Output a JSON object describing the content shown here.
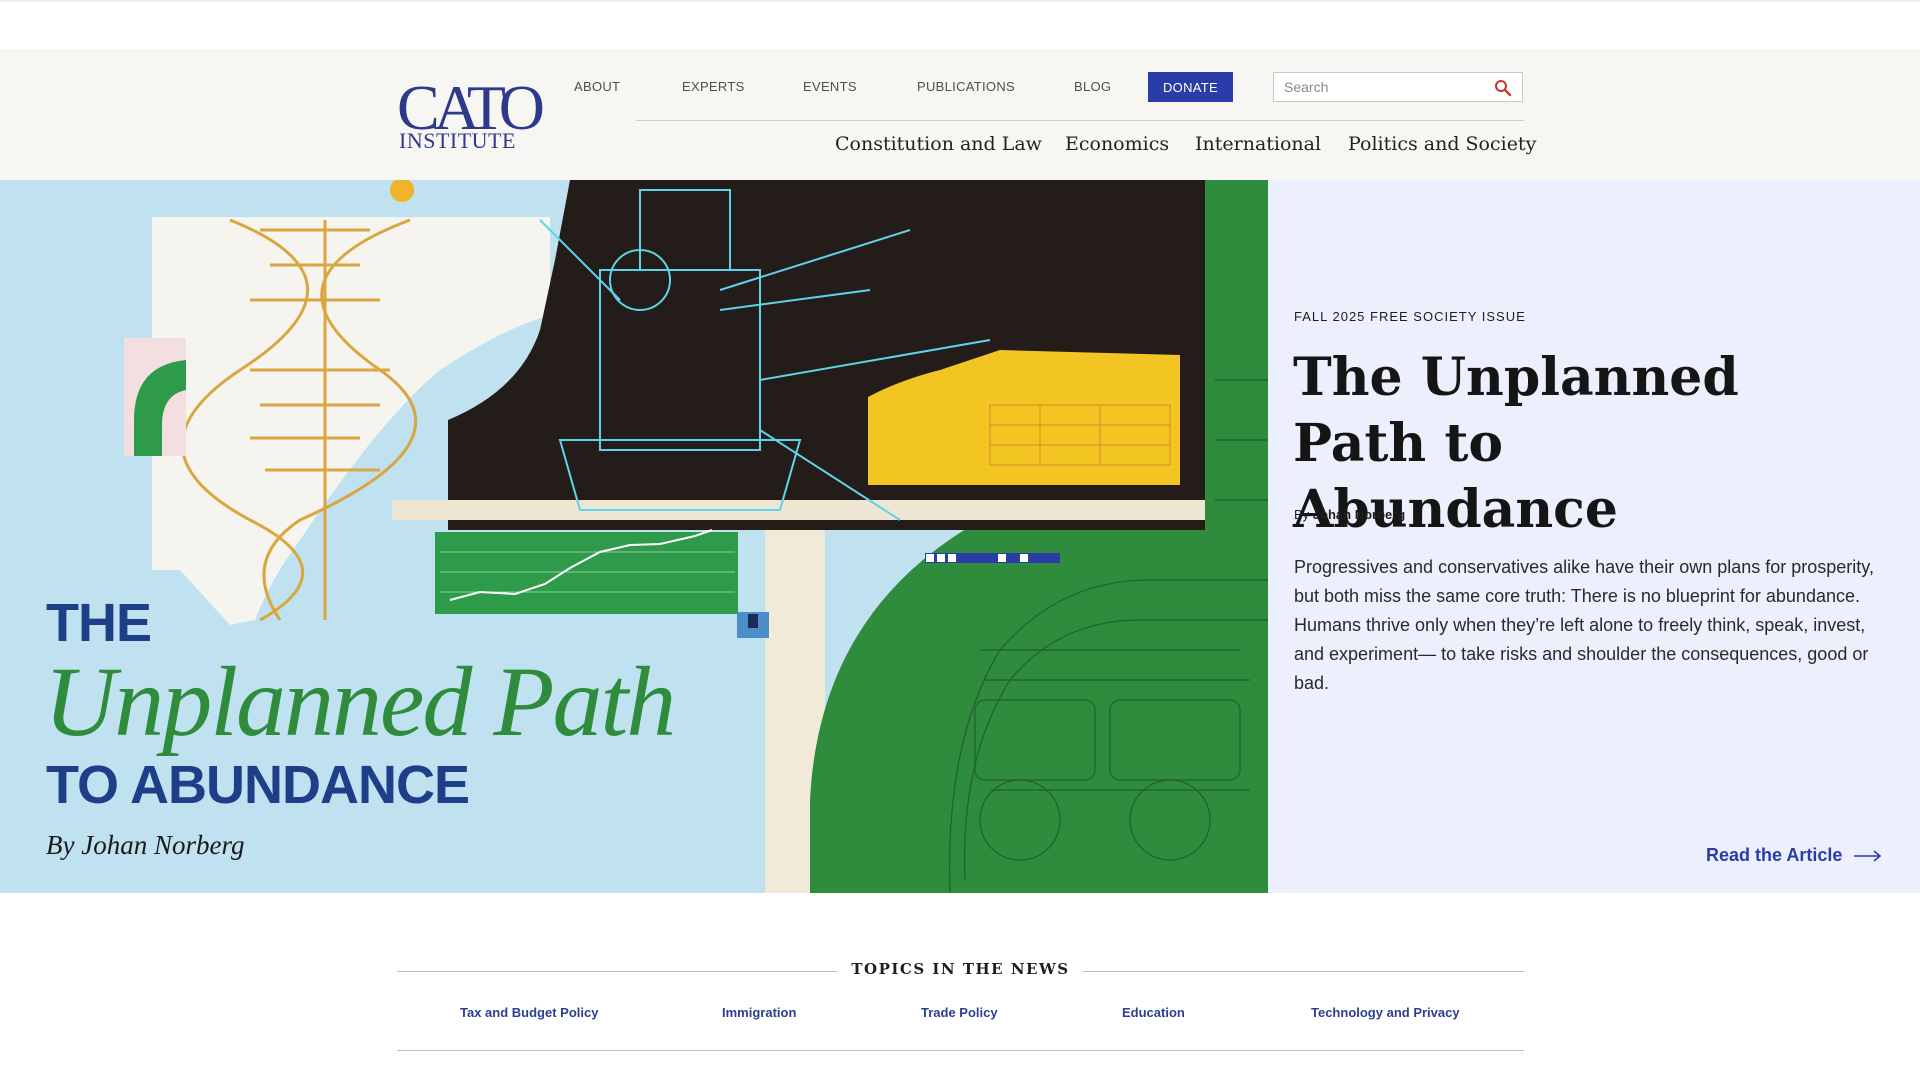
{
  "logo": {
    "top": "CATO",
    "bottom": "INSTITUTE"
  },
  "utility_nav": [
    {
      "label": "ABOUT"
    },
    {
      "label": "EXPERTS"
    },
    {
      "label": "EVENTS"
    },
    {
      "label": "PUBLICATIONS"
    },
    {
      "label": "BLOG"
    }
  ],
  "donate_label": "DONATE",
  "search": {
    "placeholder": "Search",
    "icon": "magnifier-icon"
  },
  "main_nav": [
    {
      "label": "Constitution and Law"
    },
    {
      "label": "Economics"
    },
    {
      "label": "International"
    },
    {
      "label": "Politics and Society"
    }
  ],
  "hero": {
    "art": {
      "the": "THE",
      "path": "Unplanned Path",
      "abundance": "TO ABUNDANCE",
      "byline": "By Johan Norberg"
    },
    "eyebrow": "FALL 2025 FREE SOCIETY ISSUE",
    "title": "The Unplanned Path to Abundance",
    "by_prefix": "By",
    "author": "Johan Norberg",
    "description": "Progressives and conservatives alike have their own plans for prosperity, but both miss the same core truth: There is no blueprint for abundance. Humans thrive only when they’re left alone to freely think, speak, invest, and experiment— to take risks and shoulder the consequences, good or bad.",
    "cta": "Read the Article",
    "cta_icon": "arrow-right-icon"
  },
  "topics": {
    "heading": "TOPICS IN THE NEWS",
    "items": [
      {
        "label": "Tax and Budget Policy"
      },
      {
        "label": "Immigration"
      },
      {
        "label": "Trade Policy"
      },
      {
        "label": "Education"
      },
      {
        "label": "Technology and Privacy"
      }
    ]
  },
  "colors": {
    "brand_blue": "#2a3ca8",
    "header_bg": "#f7f6f2",
    "hero_panel_bg": "#eceffc",
    "art_green": "#2f8c3c",
    "art_sky": "#bfe1f0"
  }
}
